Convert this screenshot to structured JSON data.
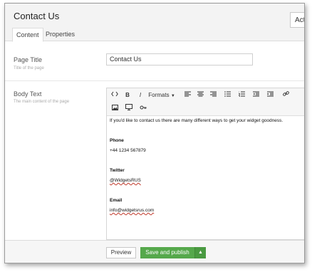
{
  "header": {
    "title": "Contact Us",
    "action_label": "Act"
  },
  "tabs": [
    {
      "label": "Content"
    },
    {
      "label": "Properties"
    }
  ],
  "fields": {
    "page_title": {
      "label": "Page Title",
      "help": "Title of the page",
      "value": "Contact Us"
    },
    "body_text": {
      "label": "Body Text",
      "help": "The main content of the page"
    }
  },
  "editor": {
    "toolbar": {
      "source_icon": "code-icon",
      "bold": "B",
      "italic": "I",
      "formats_label": "Formats"
    },
    "content": {
      "intro": "If you'd like to contact us there are many different ways to get your widget goodness.",
      "phone_label": "Phone",
      "phone_value": "+44 1234 567879",
      "twitter_label": "Twitter",
      "twitter_value": "@WidgetsRUS",
      "email_label": "Email",
      "email_value": "info@widgetsrus.com"
    }
  },
  "footer": {
    "preview_label": "Preview",
    "publish_label": "Save and publish"
  }
}
